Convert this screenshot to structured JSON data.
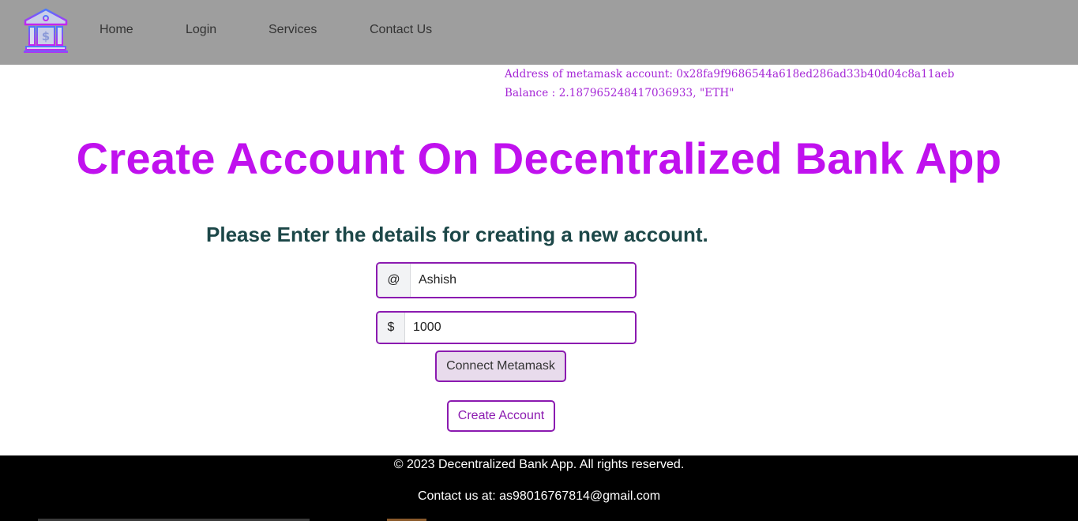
{
  "nav": {
    "logo_icon": "bank-icon",
    "links": [
      "Home",
      "Login",
      "Services",
      "Contact Us"
    ]
  },
  "account": {
    "address_line": "Address of metamask account: 0x28fa9f9686544a618ed286ad33b40d04c8a11aeb",
    "balance_line": "Balance : 2.187965248417036933, \"ETH\""
  },
  "main": {
    "title": "Create Account On Decentralized Bank App",
    "subtitle": "Please Enter the details for creating a new account."
  },
  "form": {
    "name_addon": "@",
    "name_value": "Ashish",
    "amount_addon": "$",
    "amount_value": "1000",
    "connect_label": "Connect Metamask",
    "create_label": "Create Account"
  },
  "footer": {
    "copyright": "© 2023 Decentralized Bank App. All rights reserved.",
    "contact": "Contact us at: as98016767814@gmail.com"
  },
  "colors": {
    "nav_bg": "#9e9e9e",
    "accent": "#c011ee",
    "border": "#8b1ab0",
    "subtitle": "#1c4748",
    "footer_bg": "#000000"
  }
}
